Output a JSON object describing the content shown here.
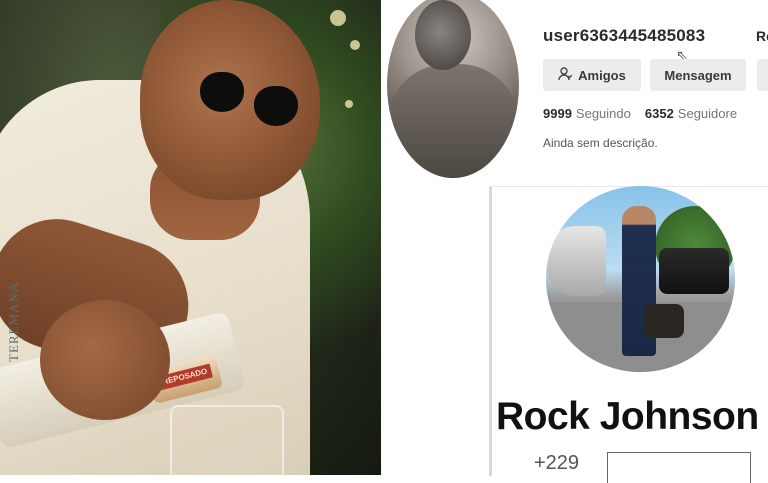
{
  "left_photo": {
    "bottle_text": "TEREMANA",
    "bottle_label": "REPOSADO"
  },
  "profile": {
    "username": "user6363445485083",
    "username_trail": "Re",
    "buttons": {
      "friends_label": "Amigos",
      "message_label": "Mensagem"
    },
    "stats": {
      "following_count": "9999",
      "following_label": "Seguindo",
      "followers_count": "6352",
      "followers_label": "Seguidore"
    },
    "description": "Ainda sem descrição."
  },
  "card": {
    "name": "Rock Johnson",
    "phone_code": "+229"
  },
  "icons": {
    "friends_icon": "person-icon",
    "cursor_icon": "pointer-cursor-icon"
  }
}
